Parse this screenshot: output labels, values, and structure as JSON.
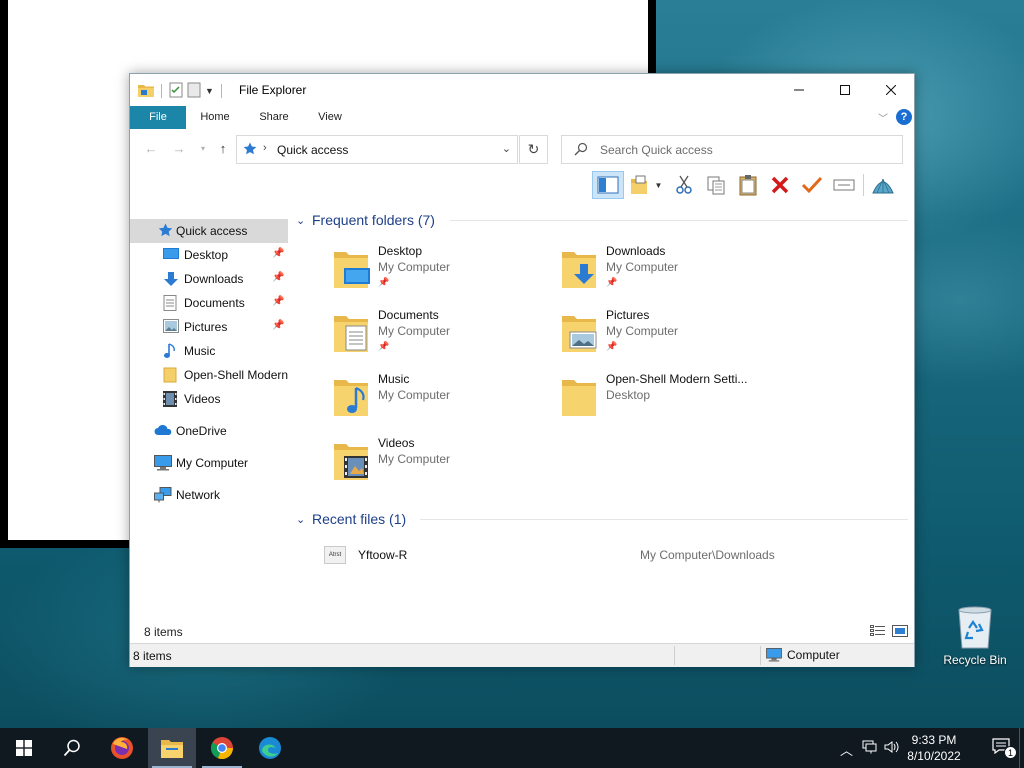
{
  "window": {
    "title": "File Explorer",
    "tabs": [
      "File",
      "Home",
      "Share",
      "View"
    ]
  },
  "address": {
    "path": "Quick access"
  },
  "search": {
    "placeholder": "Search Quick access"
  },
  "toolbar": {
    "icons": [
      "preview-pane-icon",
      "new-folder-icon",
      "cut-icon",
      "copy-icon",
      "paste-icon",
      "delete-icon",
      "rename-icon",
      "properties-icon",
      "open-shell-icon"
    ]
  },
  "nav_pane": {
    "quick_access": "Quick access",
    "items": [
      {
        "label": "Desktop",
        "pinned": true
      },
      {
        "label": "Downloads",
        "pinned": true
      },
      {
        "label": "Documents",
        "pinned": true
      },
      {
        "label": "Pictures",
        "pinned": true
      },
      {
        "label": "Music",
        "pinned": false
      },
      {
        "label": "Open-Shell Modern",
        "pinned": false
      },
      {
        "label": "Videos",
        "pinned": false
      }
    ],
    "onedrive": "OneDrive",
    "my_computer": "My Computer",
    "network": "Network"
  },
  "content": {
    "frequent_header": "Frequent folders (7)",
    "folders": [
      {
        "name": "Desktop",
        "location": "My Computer",
        "pinned": true
      },
      {
        "name": "Downloads",
        "location": "My Computer",
        "pinned": true
      },
      {
        "name": "Documents",
        "location": "My Computer",
        "pinned": true
      },
      {
        "name": "Pictures",
        "location": "My Computer",
        "pinned": true
      },
      {
        "name": "Music",
        "location": "My Computer",
        "pinned": false
      },
      {
        "name": "Open-Shell Modern Setti...",
        "location": "Desktop",
        "pinned": false
      },
      {
        "name": "Videos",
        "location": "My Computer",
        "pinned": false
      }
    ],
    "recent_header": "Recent files (1)",
    "recent_files": [
      {
        "name": "Yftoow-R",
        "path": "My Computer\\Downloads",
        "icon_text": "Atrst"
      }
    ]
  },
  "status": {
    "inner_count": "8 items",
    "bar_count": "8 items",
    "location": "Computer"
  },
  "desktop": {
    "recycle_bin": "Recycle Bin"
  },
  "taskbar": {
    "apps": [
      "start-icon",
      "search-icon",
      "firefox-icon",
      "file-explorer-icon",
      "chrome-icon",
      "edge-icon"
    ],
    "time": "9:33 PM",
    "date": "8/10/2022",
    "notification_count": "1"
  },
  "colors": {
    "file_tab": "#1b86a8",
    "group_header": "#1e3f8a",
    "taskbar": "#101820"
  }
}
